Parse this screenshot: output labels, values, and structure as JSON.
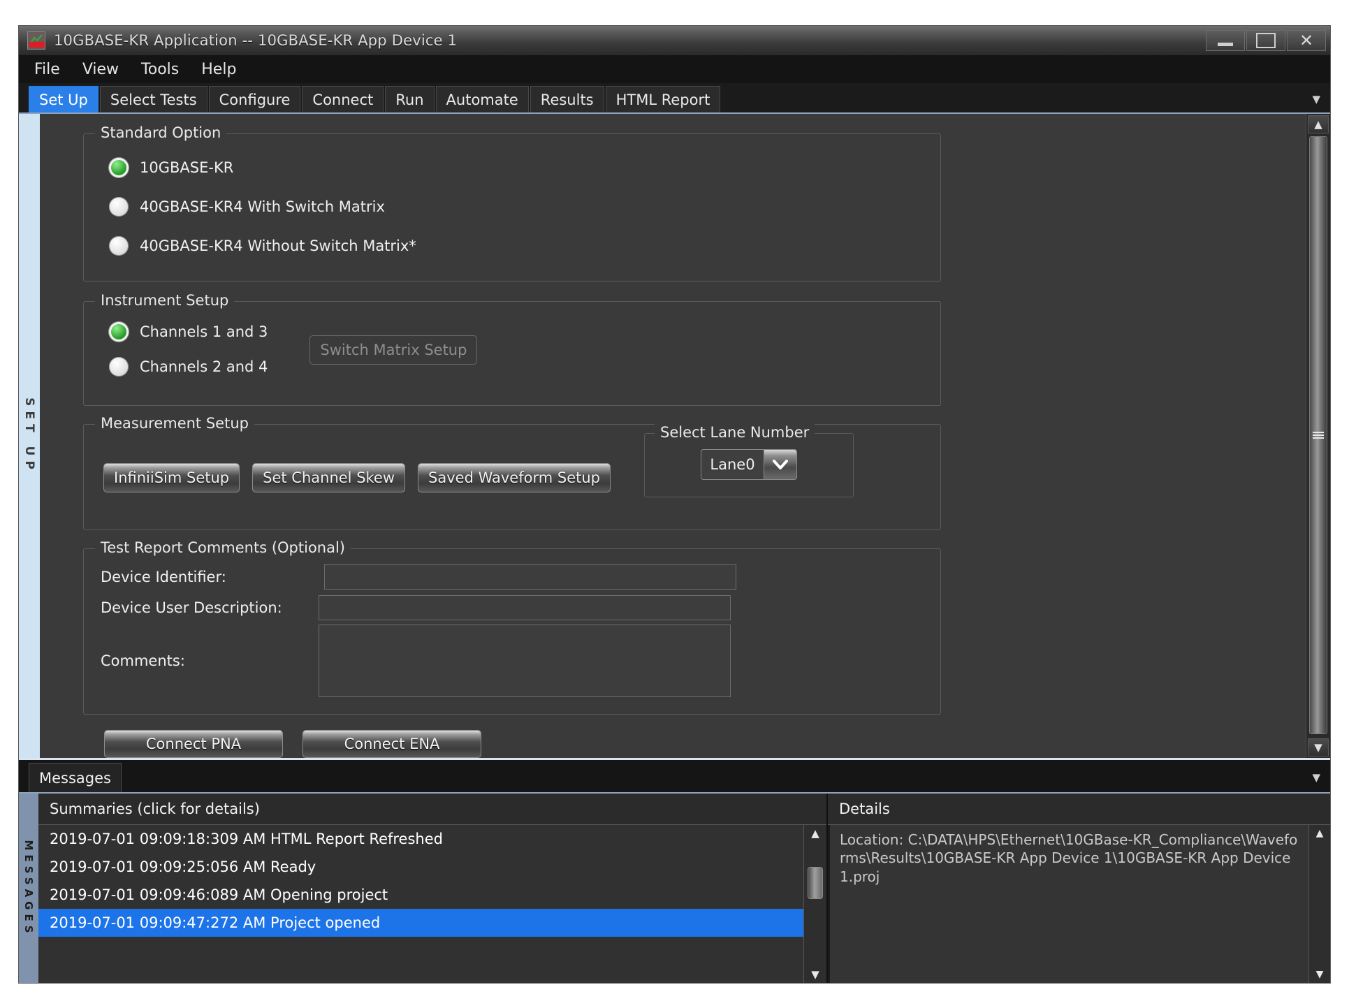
{
  "window": {
    "title": "10GBASE-KR Application -- 10GBASE-KR App Device 1",
    "icon": "app-chart-icon",
    "minimize_label": "–",
    "maximize_label": "□",
    "close_label": "✕"
  },
  "menubar": {
    "items": [
      {
        "label": "File"
      },
      {
        "label": "View"
      },
      {
        "label": "Tools"
      },
      {
        "label": "Help"
      }
    ]
  },
  "tabs": {
    "items": [
      {
        "label": "Set Up",
        "active": true
      },
      {
        "label": "Select Tests",
        "active": false
      },
      {
        "label": "Configure",
        "active": false
      },
      {
        "label": "Connect",
        "active": false
      },
      {
        "label": "Run",
        "active": false
      },
      {
        "label": "Automate",
        "active": false
      },
      {
        "label": "Results",
        "active": false
      },
      {
        "label": "HTML Report",
        "active": false
      }
    ],
    "overflow_icon": "chevron-down-icon",
    "overflow_glyph": "▼"
  },
  "sidebar": {
    "setup_label": "SET UP",
    "messages_label": "MESSAGES"
  },
  "standard_option": {
    "legend": "Standard Option",
    "options": [
      {
        "label": "10GBASE-KR",
        "selected": true
      },
      {
        "label": "40GBASE-KR4 With Switch Matrix",
        "selected": false
      },
      {
        "label": "40GBASE-KR4 Without Switch Matrix*",
        "selected": false
      }
    ]
  },
  "instrument_setup": {
    "legend": "Instrument Setup",
    "options": [
      {
        "label": "Channels 1 and 3",
        "selected": true
      },
      {
        "label": "Channels 2 and 4",
        "selected": false
      }
    ],
    "switch_matrix_button": "Switch Matrix Setup"
  },
  "measurement_setup": {
    "legend": "Measurement Setup",
    "buttons": [
      {
        "label": "InfiniiSim Setup"
      },
      {
        "label": "Set Channel Skew"
      },
      {
        "label": "Saved Waveform Setup"
      }
    ],
    "lane": {
      "legend": "Select Lane Number",
      "value": "Lane0",
      "arrow_icon": "chevron-down-icon",
      "arrow_glyph": "❯"
    }
  },
  "test_report_comments": {
    "legend": "Test Report Comments (Optional)",
    "fields": [
      {
        "label": "Device Identifier:",
        "value": "",
        "placeholder": ""
      },
      {
        "label": "Device User Description:",
        "value": "",
        "placeholder": ""
      },
      {
        "label": "Comments:",
        "value": "",
        "placeholder": ""
      }
    ]
  },
  "footer_buttons": [
    {
      "label": "Connect PNA"
    },
    {
      "label": "Connect ENA"
    }
  ],
  "messages": {
    "tab_label": "Messages",
    "overflow_glyph": "▼",
    "summaries_header": "Summaries (click for details)",
    "details_header": "Details",
    "rows": [
      {
        "text": "2019-07-01 09:09:18:309 AM HTML Report Refreshed",
        "selected": false
      },
      {
        "text": "2019-07-01 09:09:25:056 AM Ready",
        "selected": false
      },
      {
        "text": "2019-07-01 09:09:46:089 AM Opening project",
        "selected": false
      },
      {
        "text": "2019-07-01 09:09:47:272 AM Project opened",
        "selected": true
      }
    ],
    "details_text": "Location: C:\\DATA\\HPS\\Ethernet\\10GBase-KR_Compliance\\Waveforms\\Results\\10GBASE-KR App Device 1\\10GBASE-KR App Device 1.proj",
    "scroll_up_glyph": "▲",
    "scroll_down_glyph": "▼"
  },
  "colors": {
    "accent": "#2a7fe8",
    "selection": "#1d74e8",
    "panel_bg": "#3a3a3a",
    "sidebar_setup": "#cfe3f2",
    "sidebar_messages": "#7f93ad",
    "radio_on": "#2aa02a"
  }
}
